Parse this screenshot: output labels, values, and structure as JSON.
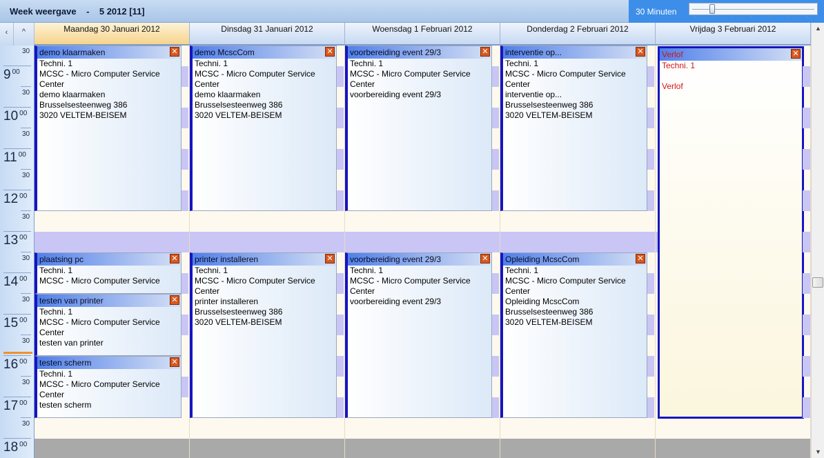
{
  "title": {
    "view": "Week weergave",
    "separator": "-",
    "week": "5  2012 [11]"
  },
  "zoom": {
    "label": "30 Minuten"
  },
  "nav": {
    "prev_icon": "‹",
    "up_icon": "^"
  },
  "days": [
    {
      "label": "Maandag 30 Januari 2012",
      "today": true
    },
    {
      "label": "Dinsdag 31 Januari 2012"
    },
    {
      "label": "Woensdag 1 Februari 2012"
    },
    {
      "label": "Donderdag 2 Februari 2012"
    },
    {
      "label": "Vrijdag 3 Februari 2012"
    }
  ],
  "time_labels": {
    "hours": [
      "9",
      "10",
      "11",
      "12",
      "13",
      "14",
      "15",
      "16",
      "17",
      "18"
    ],
    "minutes_full": "00",
    "minutes_half": "30"
  },
  "appointments": [
    {
      "day": 0,
      "title": "demo klaarmaken",
      "lines": [
        "Techni. 1",
        "MCSC - Micro Computer Service",
        "Center",
        "demo klaarmaken",
        "Brusselsesteenweg 386",
        "3020 VELTEM-BEISEM"
      ]
    },
    {
      "day": 1,
      "title": "demo McscCom",
      "lines": [
        "Techni. 1",
        "MCSC - Micro Computer Service",
        "Center",
        "demo klaarmaken",
        "Brusselsesteenweg 386",
        "3020 VELTEM-BEISEM"
      ]
    },
    {
      "day": 2,
      "title": "voorbereiding event 29/3",
      "lines": [
        "Techni. 1",
        "MCSC - Micro Computer Service",
        "Center",
        "voorbereiding event 29/3"
      ]
    },
    {
      "day": 3,
      "title": "interventie op...",
      "lines": [
        "Techni. 1",
        "MCSC - Micro Computer Service",
        "Center",
        "interventie op...",
        "Brusselsesteenweg 386",
        "3020 VELTEM-BEISEM"
      ]
    },
    {
      "day": 0,
      "title": "plaatsing pc",
      "lines": [
        "Techni. 1",
        "MCSC - Micro Computer Service"
      ]
    },
    {
      "day": 0,
      "title": "testen van printer",
      "lines": [
        "Techni. 1",
        "MCSC - Micro Computer Service",
        "Center",
        "testen van printer"
      ]
    },
    {
      "day": 0,
      "title": "testen scherm",
      "lines": [
        "Techni. 1",
        "MCSC - Micro Computer Service",
        "Center",
        "testen scherm"
      ]
    },
    {
      "day": 1,
      "title": "printer installeren",
      "lines": [
        "Techni. 1",
        "MCSC - Micro Computer Service",
        "Center",
        "printer installeren",
        "Brusselsesteenweg 386",
        "3020 VELTEM-BEISEM"
      ]
    },
    {
      "day": 2,
      "title": "voorbereiding event 29/3",
      "lines": [
        "Techni. 1",
        "MCSC - Micro Computer Service",
        "Center",
        "voorbereiding event 29/3"
      ]
    },
    {
      "day": 3,
      "title": "Opleiding McscCom",
      "lines": [
        "Techni. 1",
        "MCSC - Micro Computer Service",
        "Center",
        "Opleiding McscCom",
        "Brusselsesteenweg 386",
        "3020 VELTEM-BEISEM"
      ]
    },
    {
      "day": 4,
      "title": "Verlof",
      "lines": [
        "Techni. 1",
        "",
        "Verlof"
      ],
      "verlof": true
    }
  ],
  "close_icon": "✕",
  "colors": {
    "accent": "#3d8ee8",
    "appointment_border": "#1515c0",
    "verlof_text": "#d01515",
    "now_line": "#f0912a"
  },
  "scrollbar": {
    "up_icon": "▲",
    "down_icon": "▼"
  }
}
